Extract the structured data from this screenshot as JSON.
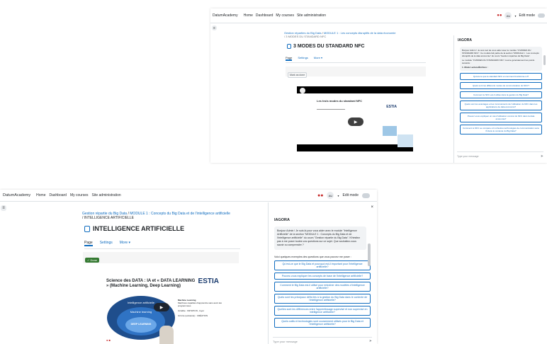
{
  "common": {
    "brand": "DatumAcademy",
    "nav": [
      "Home",
      "Dashboard",
      "My courses",
      "Site administration"
    ],
    "user_initials": "AU",
    "edit_mode": "Edit mode",
    "tabs": [
      "Page",
      "Settings",
      "More"
    ],
    "panel_title": "IAGORA",
    "input_placeholder": "Type your message",
    "colors": {
      "link": "#0f6cbf",
      "done": "#357a32",
      "brand_red": "#c62828"
    }
  },
  "screen1": {
    "breadcrumb": [
      "Gestion réparties du Big Data",
      "MODULE 1 : Les concepts disruptifs de la data économie"
    ],
    "breadcrumb_current": "3 MODES DU STANDARD NFC",
    "page_title": "3 MODES DU STANDARD NFC",
    "mark_done": "Mark as done",
    "video_slide_title": "Les trois modes du standard NFC",
    "video_logo": "ESTIA",
    "chat_intro": "Bonjour Admin ! Je suis ravi de vous aider avec le module \"3 MODES DU STANDARD NFC\". Ce module fait partie de la section \"MODULE 1 : Les concepts disruptifs de la data économie\" du cours \"Gestion réparties du Big Data\".",
    "chat_intro2": "Le module \"3 MODES DU STANDARD NFC\" couvre généralement les points suivants :",
    "chat_point": "1. Mode Lecture/Écriture :",
    "questions": [
      "Qu'est-ce que le standard NFC et comment fonctionne-t-il?",
      "Quels sont les différents modes de communication du NFC?",
      "Comment le NFC est-il utilisé dans la gestion du Big Data?",
      "Quels sont les avantages et les inconvénients de l'utilisation du NFC dans les applications de data économie?",
      "Pouvez-vous expliquer un cas d'utilisation concret du NFC dans la data économie?",
      "Comment le NFC se compare-t-il à d'autres technologies de communication sans fil dans le contexte du Big Data?"
    ]
  },
  "screen2": {
    "breadcrumb": [
      "Gestion répartie du Big Data",
      "MODULE 1 : Concepts du Big Data et de l'intelligence artificielle"
    ],
    "breadcrumb_current": "INTELLIGENCE ARTIFICIELLE",
    "page_title": "INTELLIGENCE ARTIFICIELLE",
    "done_label": "✓ Done",
    "slide_title": "Science des DATA : IA et « DATA LEARNING » (Machine Learning, Deep Learning)",
    "slide_logo": "ESTIA",
    "diagram": [
      "Intelligence artificielle",
      "Machine learning",
      "DEEP LEARNING"
    ],
    "slide_notes": [
      "Machine Learning",
      "Machines capables d'apprendre sans avoir été programmées",
      "IA faible : IMITATION , foyer",
      "IA forte (existante) : CRÉATION"
    ],
    "chat_intro": "Bonjour Admin ! Je suis là pour vous aider avec le module \"Intelligence Artificielle\" de la section \"MODULE 1 : Concepts du Big Data et de l'intelligence artificielle\" du cours \"Gestion répartie du Big Data\". N'hésitez pas à me poser toutes vos questions sur ce sujet. Que souhaitez-vous savoir ou comprendre ?",
    "chat_examples": "Voici quelques exemples des questions que vous pouvez me poser :",
    "questions": [
      "Qu'est-ce que le Big Data et pourquoi est-il important pour l'intelligence artificielle?",
      "Pouvez-vous expliquer les concepts de base de l'intelligence artificielle?",
      "Comment le Big Data est-il utilisé pour entraîner des modèles d'intelligence artificielle?",
      "Quels sont les principaux défis liés à la gestion du Big Data dans le contexte de l'intelligence artificielle?",
      "Quelles sont les différences entre l'apprentissage supervisé et non supervisé en intelligence artificielle?",
      "Quels outils et technologies sont couramment utilisés pour le Big Data et l'intelligence artificielle?"
    ]
  }
}
